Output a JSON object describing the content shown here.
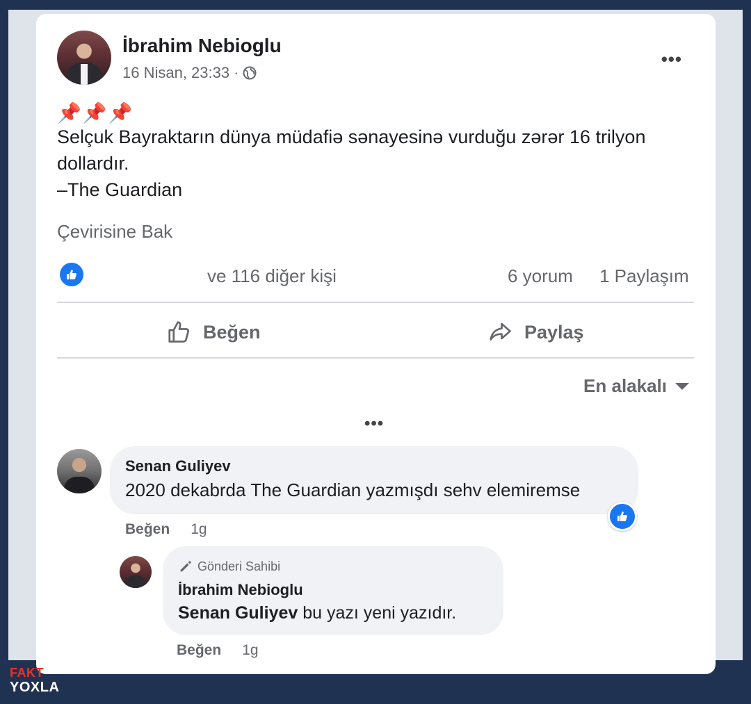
{
  "post": {
    "author": "İbrahim Nebioglu",
    "timestamp": "16 Nisan, 23:33",
    "separator": "·",
    "pins": "📌📌📌",
    "text_lines": [
      "Selçuk Bayraktarın dünya müdafiə sənayesinə vurduğu zərər 16 trilyon",
      "dollardır.",
      "–The Guardian"
    ],
    "translate_link": "Çevirisine Bak",
    "more_icon": "more-dots-icon",
    "privacy_icon": "globe-icon"
  },
  "stats": {
    "reactions": "ve 116 diğer kişi",
    "comments": "6 yorum",
    "shares": "1 Paylaşım"
  },
  "actions": {
    "like": "Beğen",
    "share": "Paylaş"
  },
  "sort": {
    "label": "En alakalı"
  },
  "comments": [
    {
      "name": "Senan Guliyev",
      "text": "2020 dekabrda The Guardian yazmışdı sehv elemiremse",
      "like": "Beğen",
      "time": "1g"
    }
  ],
  "reply": {
    "badge": "Gönderi Sahibi",
    "name": "İbrahim Nebioglu",
    "mention": "Senan Guliyev",
    "text": " bu yazı yeni yazıdır.",
    "like": "Beğen",
    "time": "1g"
  },
  "watermark": {
    "line1": "FAKT",
    "line2": "YOXLA"
  },
  "colors": {
    "accent": "#1a77f2",
    "frame": "#1f3252",
    "logo_red": "#e8332a"
  }
}
